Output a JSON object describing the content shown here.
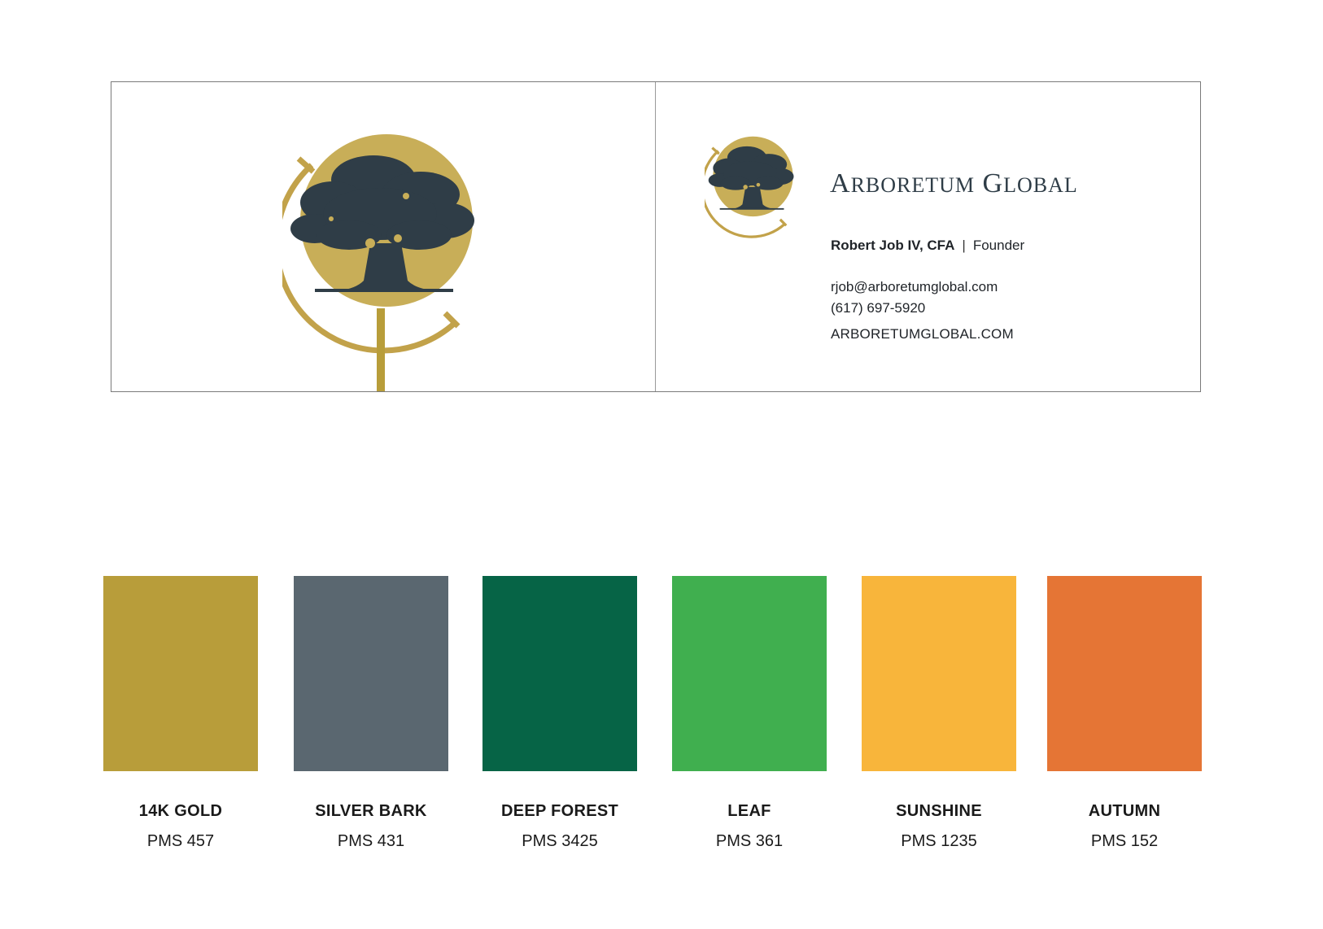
{
  "business_card": {
    "brand_name_first_cap": "A",
    "brand_name_first_rest": "RBORETUM",
    "brand_name_second_cap": "G",
    "brand_name_second_rest": "LOBAL",
    "person_name": "Robert Job IV, CFA",
    "separator": "|",
    "person_title": "Founder",
    "email": "rjob@arboretumglobal.com",
    "phone": "(617) 697-5920",
    "website": "ARBORETUMGLOBAL.COM"
  },
  "logo_colors": {
    "gold": "#C8AE58",
    "ring": "#C2A24A",
    "tree": "#2F3D47"
  },
  "palette": [
    {
      "name": "14K GOLD",
      "code": "PMS 457",
      "color": "#B89D3A"
    },
    {
      "name": "SILVER BARK",
      "code": "PMS 431",
      "color": "#5A6770"
    },
    {
      "name": "DEEP FOREST",
      "code": "PMS 3425",
      "color": "#066446"
    },
    {
      "name": "LEAF",
      "code": "PMS 361",
      "color": "#40AF4F"
    },
    {
      "name": "SUNSHINE",
      "code": "PMS 1235",
      "color": "#F8B53B"
    },
    {
      "name": "AUTUMN",
      "code": "PMS 152",
      "color": "#E57535"
    }
  ]
}
